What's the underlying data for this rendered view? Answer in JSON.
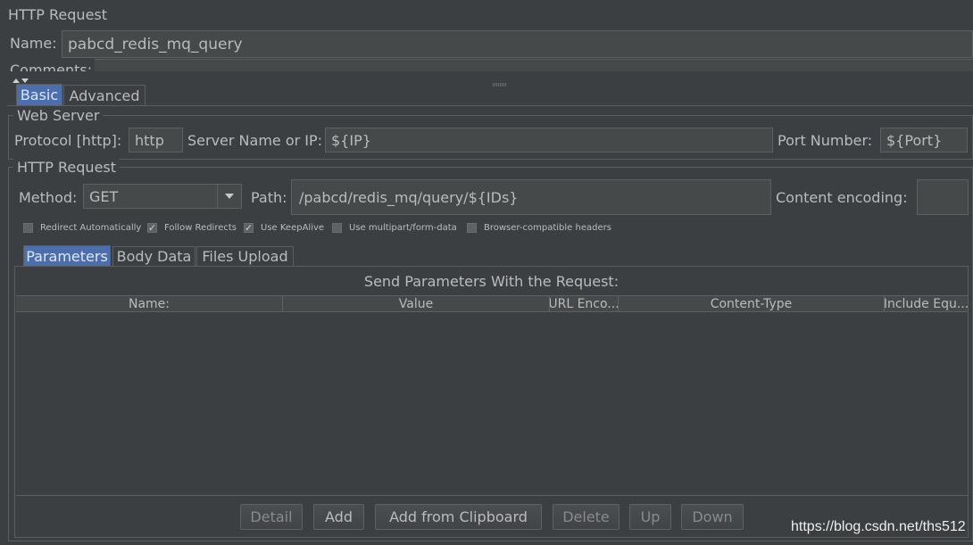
{
  "panel": {
    "title": "HTTP Request"
  },
  "name_field": {
    "label": "Name:",
    "value": "pabcd_redis_mq_query"
  },
  "comments": {
    "label": "Comments:"
  },
  "main_tabs": [
    {
      "label": "Basic",
      "selected": true
    },
    {
      "label": "Advanced",
      "selected": false
    }
  ],
  "web_server": {
    "title": "Web Server",
    "protocol_label": "Protocol [http]:",
    "protocol_value": "http",
    "server_label": "Server Name or IP:",
    "server_value": "${IP}",
    "port_label": "Port Number:",
    "port_value": "${Port}"
  },
  "http_request": {
    "title": "HTTP Request",
    "method_label": "Method:",
    "method_value": "GET",
    "path_label": "Path:",
    "path_value": "/pabcd/redis_mq/query/${IDs}",
    "encoding_label": "Content encoding:",
    "encoding_value": ""
  },
  "options": [
    {
      "label": "Redirect Automatically",
      "checked": false
    },
    {
      "label": "Follow Redirects",
      "checked": true
    },
    {
      "label": "Use KeepAlive",
      "checked": true
    },
    {
      "label": "Use multipart/form-data",
      "checked": false
    },
    {
      "label": "Browser-compatible headers",
      "checked": false
    }
  ],
  "sub_tabs": [
    {
      "label": "Parameters",
      "selected": true
    },
    {
      "label": "Body Data",
      "selected": false
    },
    {
      "label": "Files Upload",
      "selected": false
    }
  ],
  "params": {
    "title": "Send Parameters With the Request:",
    "columns": [
      "Name:",
      "Value",
      "URL Enco...",
      "Content-Type",
      "Include Equ..."
    ]
  },
  "buttons": {
    "detail": "Detail",
    "add": "Add",
    "add_clipboard": "Add from Clipboard",
    "delete": "Delete",
    "up": "Up",
    "down": "Down"
  },
  "watermark": "https://blog.csdn.net/ths512"
}
